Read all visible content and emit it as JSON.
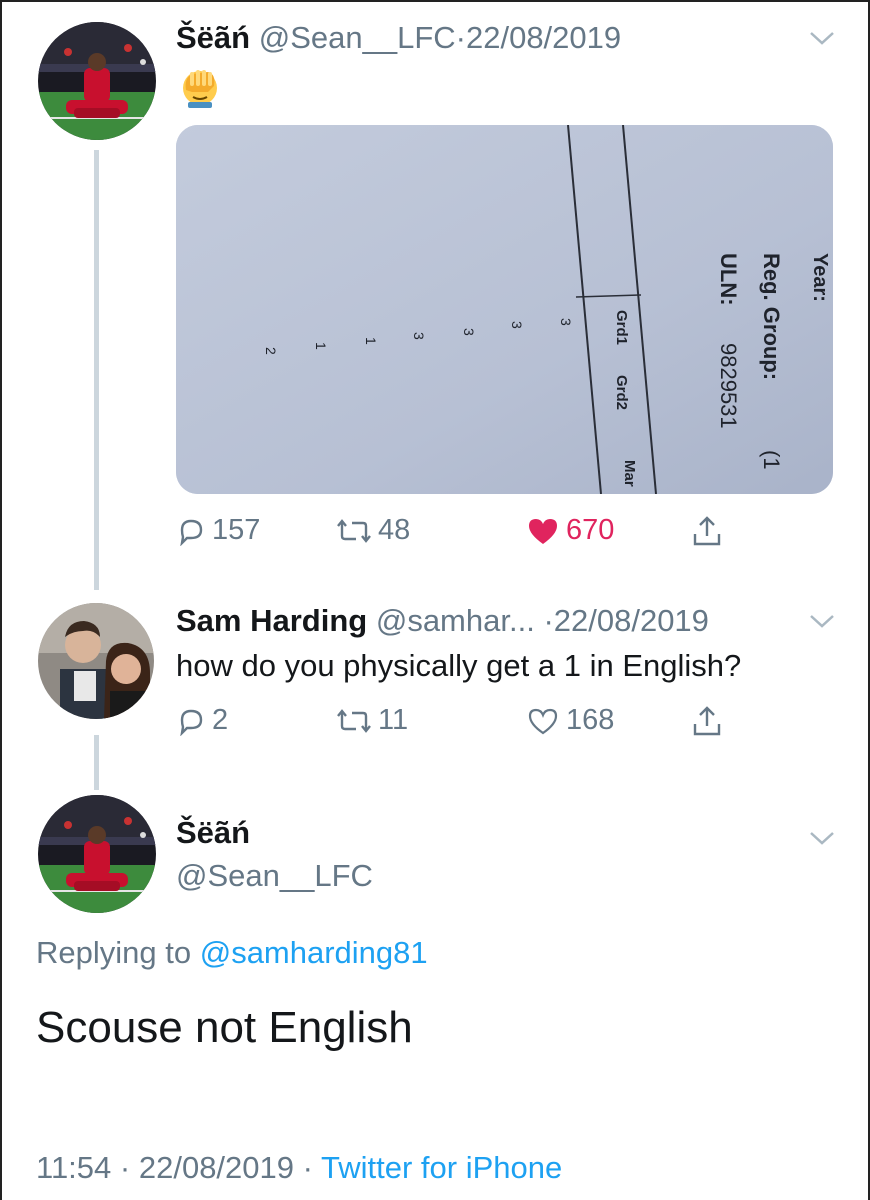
{
  "tweet1": {
    "display_name": "Šëãń",
    "handle": "@Sean__LFC",
    "separator": "·",
    "date": "22/08/2019",
    "emoji_icon": "face-palm-icon",
    "media_text": {
      "header_year": "Year:",
      "header_reg_group": "Reg. Group:",
      "header_reg_group_value": "(1",
      "header_uln": "ULN:",
      "header_uln_value": "9829531",
      "col1": "Grd1",
      "col2": "Grd2",
      "col3": "Mar",
      "grades": [
        "3",
        "3",
        "3",
        "3",
        "1",
        "1",
        "2"
      ]
    },
    "replies": "157",
    "retweets": "48",
    "likes": "670",
    "liked": true
  },
  "tweet2": {
    "display_name": "Sam Harding",
    "handle": "@samhar...",
    "separator": "·",
    "date": "22/08/2019",
    "text": "how do you physically get a 1 in English?",
    "replies": "2",
    "retweets": "11",
    "likes": "168"
  },
  "main_tweet": {
    "display_name": "Šëãń",
    "handle": "@Sean__LFC",
    "replying_prefix": "Replying to",
    "replying_to": "@samharding81",
    "text": "Scouse not English",
    "time": "11:54",
    "separator": "·",
    "date": "22/08/2019",
    "separator2": "·",
    "source": "Twitter for iPhone"
  },
  "colors": {
    "like": "#e0245e",
    "link": "#1da1f2",
    "secondary_text": "#657786",
    "thread_line": "#ccd6dd"
  }
}
